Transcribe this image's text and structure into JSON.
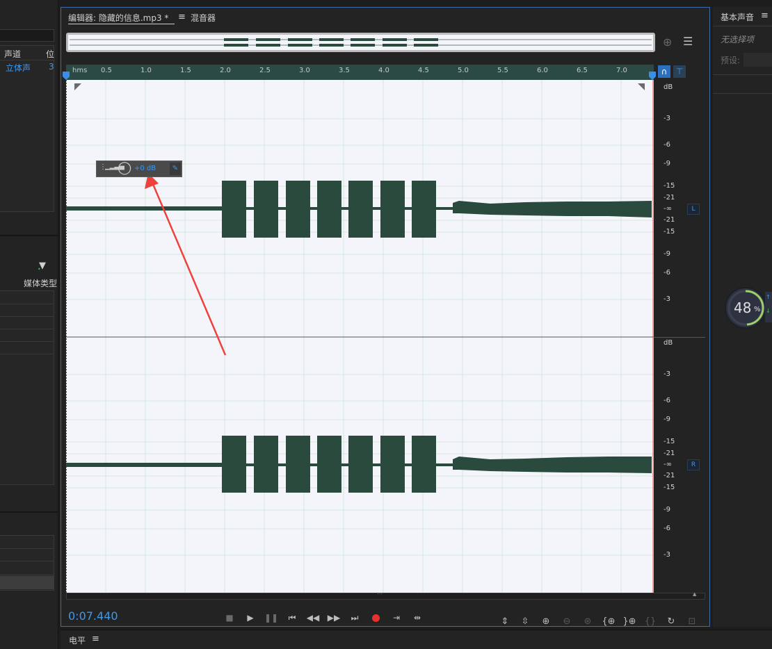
{
  "left": {
    "col_channel": "声道",
    "col_position": "位",
    "row_channel": "立体声",
    "row_position": "3",
    "media_type": "媒体类型"
  },
  "editor": {
    "tab_editor": "编辑器: 隐藏的信息.mp3 *",
    "tab_mixer": "混音器",
    "ruler_unit": "hms",
    "ruler_ticks": [
      "0.5",
      "1.0",
      "1.5",
      "2.0",
      "2.5",
      "3.0",
      "3.5",
      "4.0",
      "4.5",
      "5.0",
      "5.5",
      "6.0",
      "6.5",
      "7.0"
    ],
    "gain_value": "+0 dB",
    "db_unit": "dB",
    "db_scale": [
      "-3",
      "-6",
      "-9",
      "-15",
      "-21",
      "-∞",
      "-21",
      "-15",
      "-9",
      "-6",
      "-3"
    ],
    "channel_left": "L",
    "channel_right": "R",
    "time_display": "0:07.440",
    "panel_level": "电平"
  },
  "right": {
    "title": "基本声音",
    "no_selection": "无选择项",
    "preset_label": "预设:",
    "cpu_value": "48",
    "cpu_unit": "%"
  },
  "colors": {
    "accent": "#2d8ceb",
    "waveform": "#2a4a3d",
    "waveform_bg": "#f4f5fb",
    "record": "#e8312f",
    "arrow": "#f0403c"
  }
}
